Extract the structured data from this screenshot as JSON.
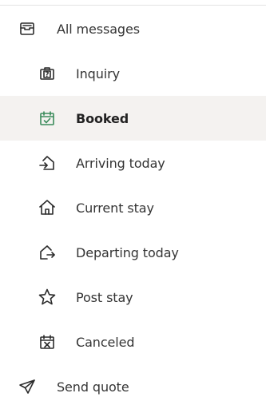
{
  "nav": {
    "items": [
      {
        "label": "All messages",
        "icon": "inbox-icon",
        "selected": false
      },
      {
        "label": "Inquiry",
        "icon": "question-briefcase-icon",
        "selected": false
      },
      {
        "label": "Booked",
        "icon": "calendar-check-icon",
        "selected": true
      },
      {
        "label": "Arriving today",
        "icon": "house-arrow-in-icon",
        "selected": false
      },
      {
        "label": "Current stay",
        "icon": "house-icon",
        "selected": false
      },
      {
        "label": "Departing today",
        "icon": "house-arrow-out-icon",
        "selected": false
      },
      {
        "label": "Post stay",
        "icon": "star-icon",
        "selected": false
      },
      {
        "label": "Canceled",
        "icon": "calendar-x-icon",
        "selected": false
      },
      {
        "label": "Send quote",
        "icon": "paper-plane-icon",
        "selected": false
      }
    ]
  },
  "colors": {
    "selected_background": "#f4f2f0",
    "selected_icon": "#3a8b5b",
    "text": "#343434"
  }
}
